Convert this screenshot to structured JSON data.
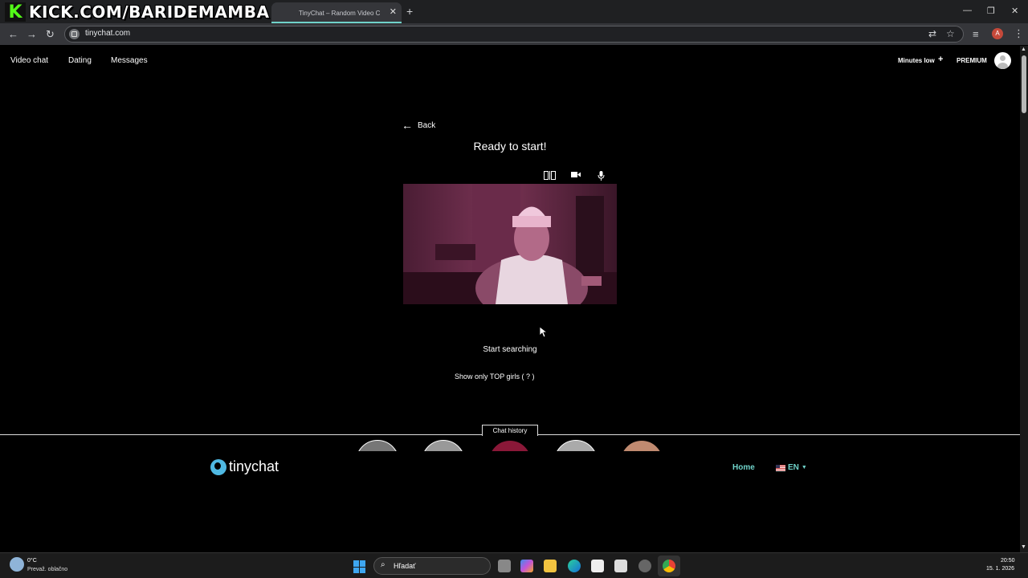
{
  "browser": {
    "tab_title": "TinyChat – Random Video C",
    "url": "tinychat.com"
  },
  "overlay": {
    "kick_logo": "K",
    "kick_text": "KICK.COM/BARIDEMAMBA"
  },
  "site_nav": {
    "links": [
      "Video chat",
      "Dating",
      "Messages"
    ],
    "minutes": "Minutes low",
    "plus": "+",
    "premium": "PREMIUM"
  },
  "main": {
    "back_label": "Back",
    "heading": "Ready to start!",
    "start_label": "Start searching",
    "top_girls_label": "Show only TOP girls ( ? )"
  },
  "chat_history": {
    "label": "Chat history"
  },
  "footer": {
    "logo_text": "tinychat",
    "home": "Home",
    "lang": "EN"
  },
  "taskbar": {
    "weather_temp": "0°C",
    "weather_desc": "Prevaž. oblačno",
    "search_placeholder": "Hľadať",
    "time": "20:50",
    "date": "15. 1. 2026"
  },
  "colors": {
    "accent": "#6fd2c9",
    "kick_green": "#53fc18",
    "video_tint": "#5a2440"
  }
}
